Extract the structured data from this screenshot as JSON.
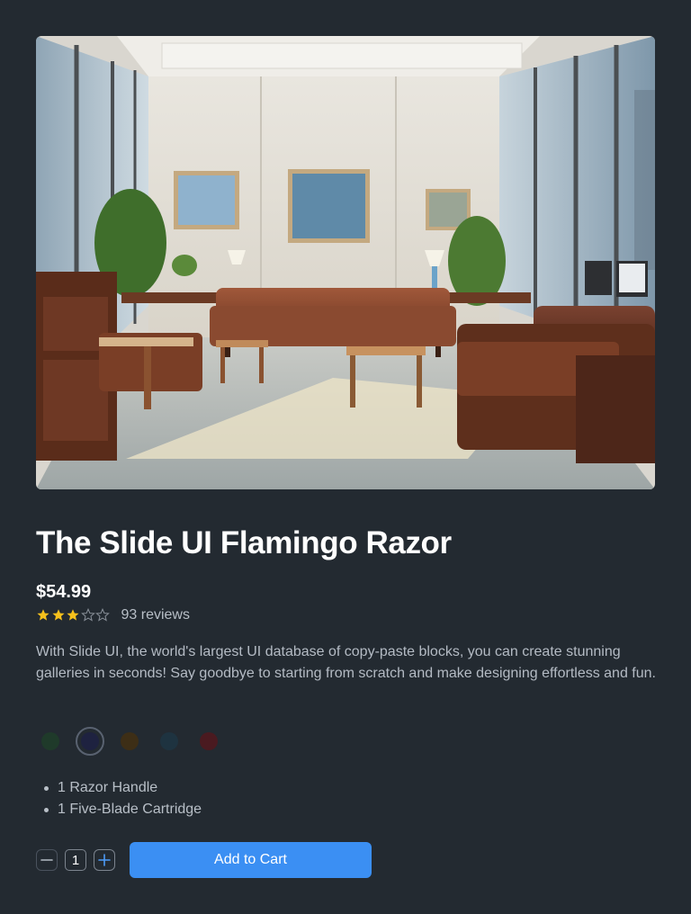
{
  "product": {
    "title": "The Slide UI Flamingo Razor",
    "price": "$54.99",
    "rating": 3,
    "rating_max": 5,
    "reviews": "93 reviews",
    "description": "With Slide UI, the world's largest UI database of copy-paste blocks, you can create stunning galleries in seconds! Say goodbye to starting from scratch and make designing effortless and fun.",
    "colors": [
      {
        "hex": "#1f3a2a",
        "selected": false
      },
      {
        "hex": "#1e2240",
        "selected": true
      },
      {
        "hex": "#3d2e16",
        "selected": false
      },
      {
        "hex": "#1e3340",
        "selected": false
      },
      {
        "hex": "#4a1a20",
        "selected": false
      }
    ],
    "features": [
      "1 Razor Handle",
      "1 Five-Blade Cartridge"
    ]
  },
  "cart": {
    "quantity": "1",
    "add_label": "Add to Cart"
  },
  "theme": {
    "background": "#232a31",
    "accent": "#3b8ff3",
    "star_filled": "#f6c01c",
    "star_empty": "#8a919a"
  },
  "icons": {
    "decrease": "minus-icon",
    "increase": "plus-icon",
    "star": "star-icon"
  }
}
